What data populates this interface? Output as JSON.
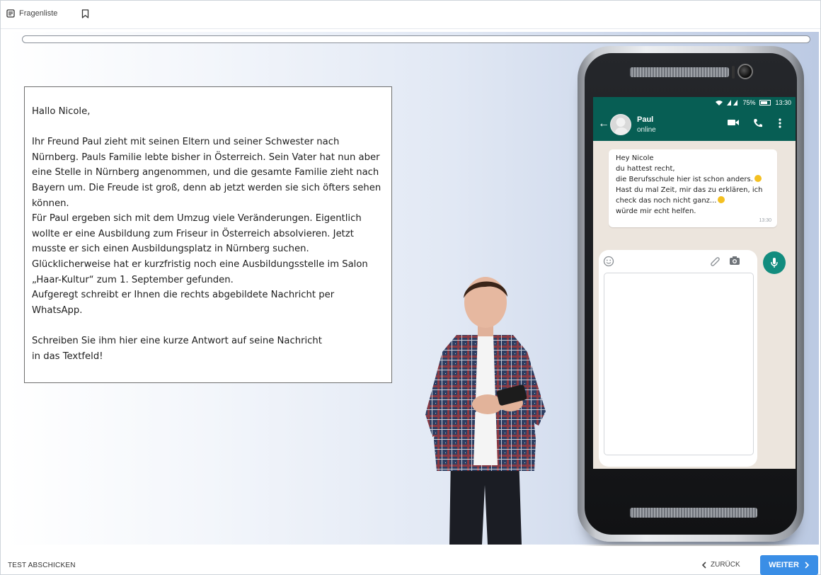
{
  "toolbar": {
    "question_list_label": "Fragenliste",
    "question_list_icon": "list-icon",
    "bookmark_icon": "bookmark-icon"
  },
  "progress": {
    "fraction": 0.0
  },
  "task": {
    "greeting": "Hallo Nicole,",
    "p1": "Ihr Freund Paul zieht mit seinen Eltern und seiner Schwester nach Nürnberg. Pauls Familie lebte bisher in Österreich. Sein Vater hat nun aber eine Stelle in Nürnberg angenommen, und die gesamte Familie zieht nach Bayern um. Die Freude ist groß, denn ab jetzt werden sie sich öfters sehen können.",
    "p2": "Für Paul ergeben sich mit dem Umzug viele Veränderungen. Eigentlich wollte er eine Ausbildung zum Friseur in Österreich absolvieren. Jetzt musste er sich einen Ausbildungsplatz in Nürnberg suchen.",
    "p3": "Glücklicherweise hat er kurzfristig noch eine Ausbildungsstelle im Salon „Haar-Kultur“ zum 1. September gefunden.",
    "p4": "Aufgeregt schreibt er Ihnen die rechts abgebildete Nachricht per WhatsApp.",
    "instruction_line1": "Schreiben Sie ihm hier eine kurze Antwort auf seine Nachricht",
    "instruction_line2": "in das Textfeld!"
  },
  "phone": {
    "status": {
      "battery": "75%",
      "time": "13:30"
    },
    "contact": {
      "name": "Paul",
      "status": "online"
    },
    "message": {
      "line1": "Hey Nicole",
      "line2": "du hattest recht,",
      "line3": "die Berufsschule hier ist schon anders.",
      "line4": "Hast du mal Zeit, mir das zu erklären, ich",
      "line5": "check das noch nicht ganz...",
      "line6": "würde mir echt helfen.",
      "time": "13:30"
    },
    "reply": {
      "value": "",
      "placeholder": ""
    },
    "colors": {
      "header": "#075e54",
      "mic": "#128c7e",
      "chat_bg": "#ece5dd"
    }
  },
  "footer": {
    "submit_label": "TEST ABSCHICKEN",
    "back_label": "ZURÜCK",
    "next_label": "WEITER",
    "next_color": "#3a8ee6"
  }
}
